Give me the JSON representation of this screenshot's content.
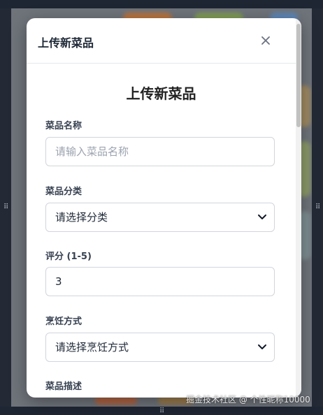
{
  "modal": {
    "title": "上传新菜品",
    "close_label": "×"
  },
  "form": {
    "heading": "上传新菜品",
    "fields": [
      {
        "label": "菜品名称",
        "placeholder": "请输入菜品名称",
        "value": ""
      },
      {
        "label": "菜品分类",
        "selected": "请选择分类"
      },
      {
        "label": "评分 (1-5)",
        "value": "3"
      },
      {
        "label": "烹饪方式",
        "selected": "请选择烹饪方式"
      },
      {
        "label": "菜品描述"
      }
    ]
  },
  "watermark": "掘金技术社区 @ 个性昵称10000",
  "handle_glyph": "⠿",
  "colors": {
    "overlay": "#6f747b",
    "frame": "#232a36",
    "modal_bg": "#ffffff",
    "border": "#d1d5db",
    "text": "#1f2937",
    "placeholder": "#9ca3af"
  }
}
